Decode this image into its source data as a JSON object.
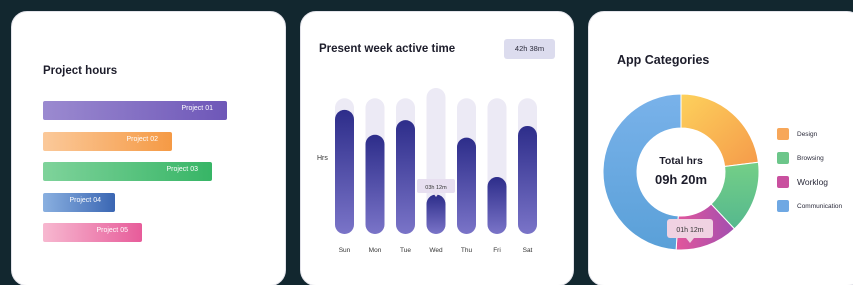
{
  "project_hours": {
    "title": "Project hours",
    "projects": [
      {
        "label": "Project 01",
        "share": 1.0,
        "color_from": "#9b8ad0",
        "color_to": "#6e57b8"
      },
      {
        "label": "Project 02",
        "share": 0.7,
        "color_from": "#fbc99a",
        "color_to": "#f59a45"
      },
      {
        "label": "Project 03",
        "share": 0.92,
        "color_from": "#7fd39b",
        "color_to": "#37b566"
      },
      {
        "label": "Project 04",
        "share": 0.39,
        "color_from": "#8ab0e0",
        "color_to": "#3a66b3"
      },
      {
        "label": "Project 05",
        "share": 0.54,
        "color_from": "#f7b8d0",
        "color_to": "#e75c9a"
      }
    ]
  },
  "week": {
    "title": "Present week active time",
    "total": "42h 38m",
    "y_label": "Hrs",
    "tooltip": "03h 12m",
    "highlight_index": 3,
    "chart_data": {
      "type": "bar",
      "categories": [
        "Sun",
        "Mon",
        "Tue",
        "Wed",
        "Thu",
        "Fri",
        "Sat"
      ],
      "values": [
        0.85,
        0.68,
        0.78,
        0.27,
        0.66,
        0.39,
        0.74
      ],
      "track": [
        0.93,
        0.93,
        0.93,
        1.0,
        0.93,
        0.93,
        0.93
      ],
      "ylim": [
        0,
        1
      ]
    }
  },
  "categories": {
    "title": "App Categories",
    "center_title": "Total hrs",
    "center_value": "09h 20m",
    "tooltip": "01h 12m",
    "legend": [
      {
        "label": "Design",
        "color": "#f7a75a"
      },
      {
        "label": "Browsing",
        "color": "#6cc68a"
      },
      {
        "label": "Worklog",
        "color": "#c9509f"
      },
      {
        "label": "Communication",
        "color": "#6fa8e3"
      }
    ],
    "chart_data": {
      "type": "pie",
      "labels": [
        "Design",
        "Browsing",
        "Worklog",
        "Communication"
      ],
      "values": [
        23,
        15,
        13,
        49
      ]
    }
  }
}
